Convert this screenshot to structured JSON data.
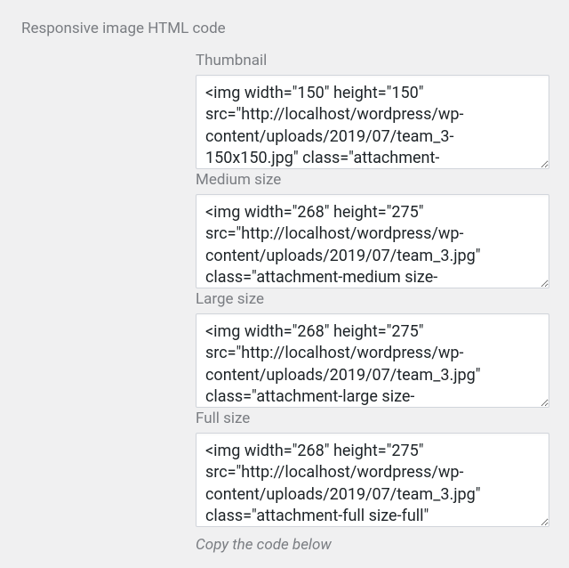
{
  "section_title": "Responsive image HTML code",
  "fields": {
    "thumbnail": {
      "label": "Thumbnail",
      "code": "<img width=\"150\" height=\"150\" src=\"http://localhost/wordpress/wp-content/uploads/2019/07/team_3-150x150.jpg\" class=\"attachment-"
    },
    "medium": {
      "label": "Medium size",
      "code": "<img width=\"268\" height=\"275\" src=\"http://localhost/wordpress/wp-content/uploads/2019/07/team_3.jpg\" class=\"attachment-medium size-"
    },
    "large": {
      "label": "Large size",
      "code": "<img width=\"268\" height=\"275\" src=\"http://localhost/wordpress/wp-content/uploads/2019/07/team_3.jpg\" class=\"attachment-large size-"
    },
    "full": {
      "label": "Full size",
      "code": "<img width=\"268\" height=\"275\" src=\"http://localhost/wordpress/wp-content/uploads/2019/07/team_3.jpg\" class=\"attachment-full size-full\""
    }
  },
  "helper_text": "Copy the code below"
}
